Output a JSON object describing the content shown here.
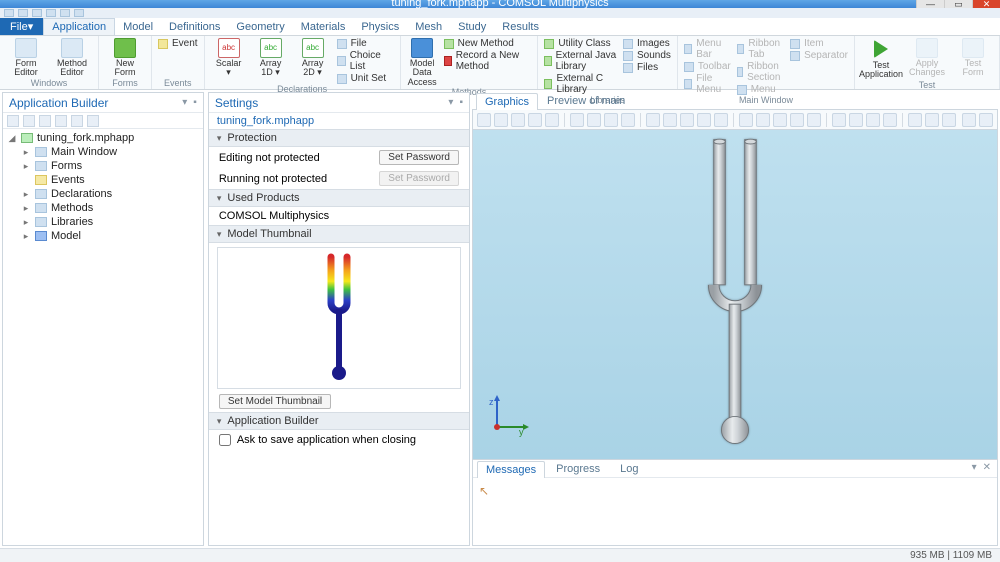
{
  "window": {
    "title": "tuning_fork.mphapp - COMSOL Multiphysics",
    "min": "—",
    "max": "▭",
    "close": "✕"
  },
  "menu": {
    "file": "File▾",
    "tabs": [
      "Application",
      "Model",
      "Definitions",
      "Geometry",
      "Materials",
      "Physics",
      "Mesh",
      "Study",
      "Results"
    ],
    "active": 0
  },
  "ribbon": {
    "groups": {
      "windows": {
        "label": "Windows",
        "form_editor": "Form\nEditor",
        "method_editor": "Method\nEditor"
      },
      "forms": {
        "label": "Forms",
        "new_form": "New\nForm"
      },
      "events": {
        "label": "Events",
        "event": "Event"
      },
      "decl": {
        "label": "Declarations",
        "scalar": "Scalar\n▾",
        "a1d": "Array\n1D ▾",
        "a2d": "Array\n2D ▾",
        "file": "File",
        "choice": "Choice List",
        "unit": "Unit Set"
      },
      "methods": {
        "label": "Methods",
        "mda": "Model Data\nAccess",
        "new_m": "New Method",
        "rec": "Record a New Method"
      },
      "libs": {
        "label": "Libraries",
        "uc": "Utility Class",
        "ejl": "External Java Library",
        "ecl": "External C Library",
        "img": "Images",
        "snd": "Sounds",
        "fls": "Files"
      },
      "mainwin": {
        "label": "Main Window",
        "mb": "Menu Bar",
        "tb": "Toolbar",
        "fm": "File Menu",
        "rt": "Ribbon Tab",
        "rs": "Ribbon Section",
        "mn": "Menu",
        "it": "Item",
        "sp": "Separator"
      },
      "test": {
        "label": "Test",
        "ta": "Test\nApplication",
        "ac": "Apply\nChanges",
        "tf": "Test\nForm"
      }
    }
  },
  "app_builder": {
    "title": "Application Builder",
    "root": "tuning_fork.mphapp",
    "nodes": [
      "Main Window",
      "Forms",
      "Events",
      "Declarations",
      "Methods",
      "Libraries",
      "Model"
    ]
  },
  "settings": {
    "title": "Settings",
    "subtitle": "tuning_fork.mphapp",
    "protection": {
      "label": "Protection",
      "edit_lbl": "Editing not protected",
      "edit_btn": "Set Password",
      "run_lbl": "Running not protected",
      "run_btn": "Set Password"
    },
    "used": {
      "label": "Used Products",
      "value": "COMSOL Multiphysics"
    },
    "thumb": {
      "label": "Model Thumbnail",
      "btn": "Set Model Thumbnail"
    },
    "ab": {
      "label": "Application Builder",
      "ask": "Ask to save application when closing"
    }
  },
  "graphics": {
    "tab1": "Graphics",
    "tab2": "Preview of main",
    "z": "z",
    "y": "y"
  },
  "messages": {
    "tabs": [
      "Messages",
      "Progress",
      "Log"
    ],
    "active": 0
  },
  "status": {
    "mem": "935 MB | 1109 MB"
  }
}
